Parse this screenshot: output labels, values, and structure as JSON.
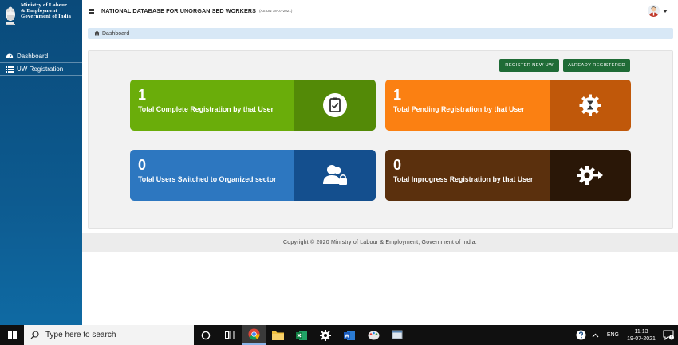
{
  "brand": {
    "line1": "Ministry of Labour",
    "line2": "& Employment",
    "line3": "Government of India"
  },
  "header": {
    "title": "NATIONAL DATABASE FOR UNORGANISED WORKERS",
    "subtitle": "(AS ON 18-07-2021)"
  },
  "sidebar": {
    "items": [
      {
        "label": "Dashboard",
        "icon": "dashboard-icon"
      },
      {
        "label": "UW Registration",
        "icon": "list-icon"
      }
    ]
  },
  "breadcrumb": {
    "label": "Dashboard"
  },
  "actions": {
    "register_new": "REGISTER NEW UW",
    "already_registered": "ALREADY REGISTERED"
  },
  "cards": [
    {
      "count": "1",
      "label": "Total Complete Registration by that User",
      "icon": "clipboard-check-icon",
      "color": "#6aad0a"
    },
    {
      "count": "1",
      "label": "Total Pending Registration by that User",
      "icon": "hourglass-gear-icon",
      "color": "#fb8012"
    },
    {
      "count": "0",
      "label": "Total Users Switched to Organized sector",
      "icon": "users-lock-icon",
      "color": "#2d77c0"
    },
    {
      "count": "0",
      "label": "Total Inprogress Registration by that User",
      "icon": "gear-arrow-icon",
      "color": "#5b300d"
    }
  ],
  "footer": {
    "copyright": "Copyright © 2020 Ministry of Labour & Employment, Government of India."
  },
  "taskbar": {
    "search_placeholder": "Type here to search",
    "language": "ENG",
    "time": "11:13",
    "date": "19-07-2021",
    "notification_count": "1"
  }
}
